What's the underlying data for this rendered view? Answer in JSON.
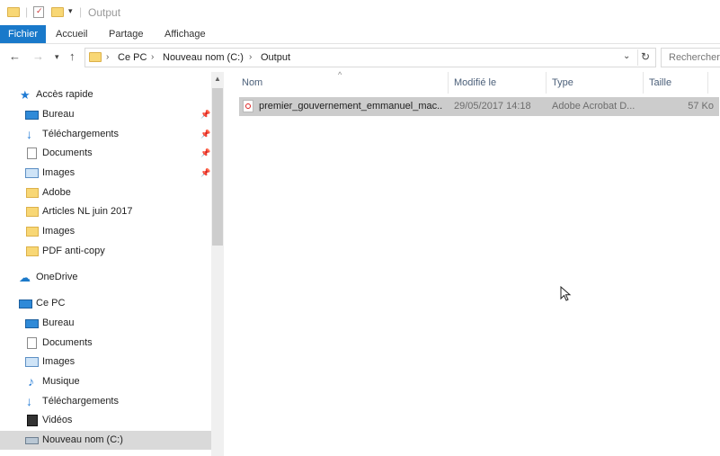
{
  "title_bar": {
    "title": "Output"
  },
  "ribbon": {
    "tabs": [
      {
        "label": "Fichier",
        "active": true
      },
      {
        "label": "Accueil",
        "active": false
      },
      {
        "label": "Partage",
        "active": false
      },
      {
        "label": "Affichage",
        "active": false
      }
    ]
  },
  "address": {
    "crumbs": [
      "Ce PC",
      "Nouveau nom (C:)",
      "Output"
    ],
    "search_placeholder": "Rechercher dans : Output"
  },
  "nav": {
    "quick_access": "Accès rapide",
    "quick_items": [
      {
        "label": "Bureau",
        "icon": "desktop-icon",
        "pinned": true
      },
      {
        "label": "Téléchargements",
        "icon": "downloads-icon",
        "pinned": true
      },
      {
        "label": "Documents",
        "icon": "documents-icon",
        "pinned": true
      },
      {
        "label": "Images",
        "icon": "pictures-icon",
        "pinned": true
      },
      {
        "label": "Adobe",
        "icon": "folder-icon",
        "pinned": false
      },
      {
        "label": "Articles NL juin 2017",
        "icon": "folder-icon",
        "pinned": false
      },
      {
        "label": "Images",
        "icon": "folder-icon",
        "pinned": false
      },
      {
        "label": "PDF anti-copy",
        "icon": "folder-icon",
        "pinned": false
      }
    ],
    "onedrive": "OneDrive",
    "this_pc": "Ce PC",
    "pc_items": [
      {
        "label": "Bureau",
        "icon": "desktop-icon"
      },
      {
        "label": "Documents",
        "icon": "documents-icon"
      },
      {
        "label": "Images",
        "icon": "pictures-icon"
      },
      {
        "label": "Musique",
        "icon": "music-icon"
      },
      {
        "label": "Téléchargements",
        "icon": "downloads-icon"
      },
      {
        "label": "Vidéos",
        "icon": "videos-icon"
      },
      {
        "label": "Nouveau nom (C:)",
        "icon": "drive-icon",
        "selected": true
      }
    ]
  },
  "list": {
    "columns": [
      "Nom",
      "Modifié le",
      "Type",
      "Taille"
    ],
    "files": [
      {
        "name": "premier_gouvernement_emmanuel_mac...",
        "modified": "29/05/2017 14:18",
        "type": "Adobe Acrobat D...",
        "size": "57 Ko",
        "icon": "pdf-icon"
      }
    ]
  }
}
